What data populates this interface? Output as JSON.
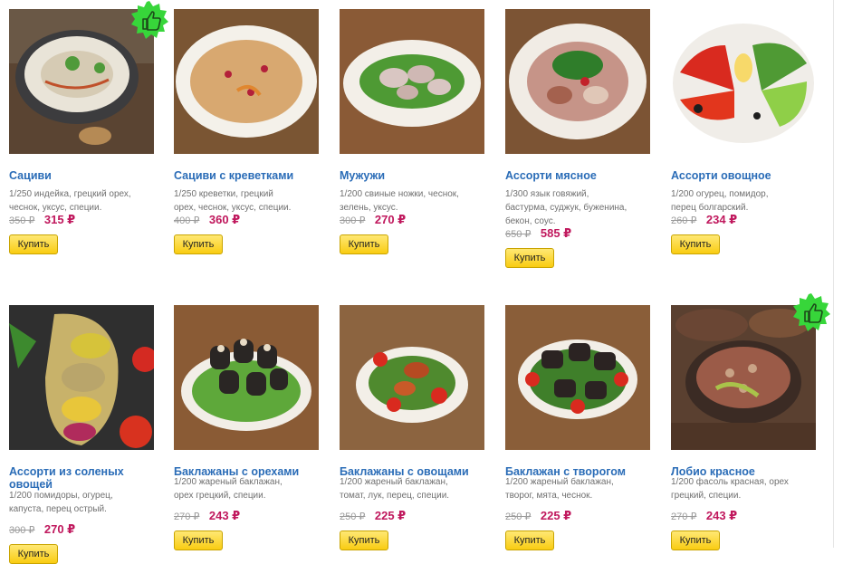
{
  "colors": {
    "title": "#2a6cb7",
    "price_new": "#c0185d",
    "price_old": "#9a9a9a",
    "button": "#f9cc12",
    "badge": "#37d63a"
  },
  "badge_icon": "thumbs-up-icon",
  "products": [
    {
      "title": "Сациви",
      "desc": [
        "1/250 индейка, грецкий орех,",
        "чеснок, уксус, специи."
      ],
      "old_price": "350 ₽",
      "price": "315 ₽",
      "buy_label": "Купить",
      "badge": true
    },
    {
      "title": "Сациви с креветками",
      "desc": [
        "1/250 креветки, грецкий",
        "орех, чеснок, уксус, специи."
      ],
      "old_price": "400 ₽",
      "price": "360 ₽",
      "buy_label": "Купить",
      "badge": false
    },
    {
      "title": "Мужужи",
      "desc": [
        "1/200 свиные ножки, чеснок,",
        "зелень, уксус."
      ],
      "old_price": "300 ₽",
      "price": "270 ₽",
      "buy_label": "Купить",
      "badge": false
    },
    {
      "title": "Ассорти мясное",
      "desc": [
        "1/300 язык говяжий,",
        "бастурма, суджук, буженина,",
        "бекон, соус."
      ],
      "old_price": "650 ₽",
      "price": "585 ₽",
      "buy_label": "Купить",
      "badge": false
    },
    {
      "title": "Ассорти овощное",
      "desc": [
        "1/200 огурец, помидор,",
        "перец болгарский."
      ],
      "old_price": "260 ₽",
      "price": "234 ₽",
      "buy_label": "Купить",
      "badge": false
    },
    {
      "title": "Ассорти из соленых овощей",
      "desc": [
        "1/200 помидоры, огурец,",
        "капуста, перец острый."
      ],
      "old_price": "300 ₽",
      "price": "270 ₽",
      "buy_label": "Купить",
      "badge": false
    },
    {
      "title": "Баклажаны с орехами",
      "desc": [
        "1/200 жареный баклажан,",
        "орех грецкий, специи."
      ],
      "old_price": "270 ₽",
      "price": "243 ₽",
      "buy_label": "Купить",
      "badge": false
    },
    {
      "title": "Баклажаны с овощами",
      "desc": [
        "1/200 жареный баклажан,",
        "томат, лук, перец, специи."
      ],
      "old_price": "250 ₽",
      "price": "225 ₽",
      "buy_label": "Купить",
      "badge": false
    },
    {
      "title": "Баклажан с творогом",
      "desc": [
        "1/200 жареный баклажан,",
        "творог, мята, чеснок."
      ],
      "old_price": "250 ₽",
      "price": "225 ₽",
      "buy_label": "Купить",
      "badge": false
    },
    {
      "title": "Лобио красное",
      "desc": [
        "1/200 фасоль красная, орех",
        "грецкий, специи."
      ],
      "old_price": "270 ₽",
      "price": "243 ₽",
      "buy_label": "Купить",
      "badge": true
    }
  ]
}
